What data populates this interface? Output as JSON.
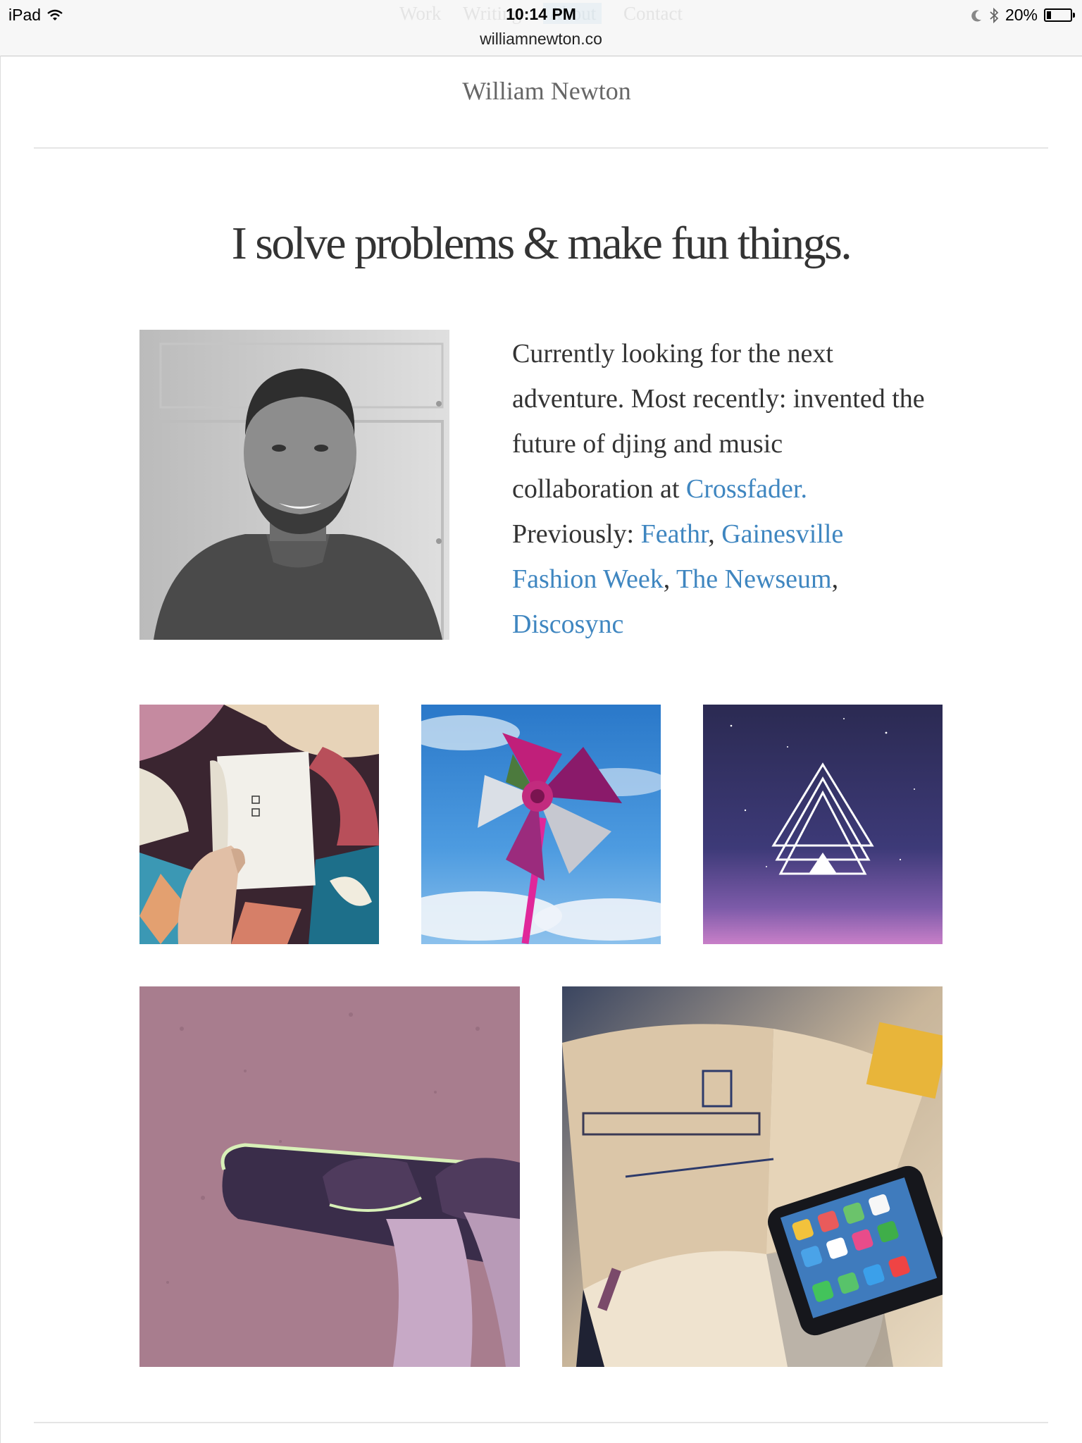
{
  "statusbar": {
    "device": "iPad",
    "time": "10:14 PM",
    "url": "williamnewton.co",
    "battery": "20%",
    "battery_level": 0.2,
    "icons": [
      "wifi-icon",
      "moon-icon",
      "bluetooth-icon",
      "battery-icon"
    ]
  },
  "ghost_nav": [
    "Work",
    "Writing",
    "About",
    "Contact"
  ],
  "site": {
    "title": "William Newton",
    "headline": "I solve problems & make fun things."
  },
  "intro": {
    "text_1": "Currently looking for the next adventure. Most recently: invented the future of djing and music collaboration at ",
    "link_crossfader": "Crossfader.",
    "text_2": " Previously: ",
    "link_feathr": "Feathr",
    "link_gfw": "Gainesville Fashion Week",
    "link_newseum": "The Newseum",
    "link_discosync": "Discosync",
    "sep": ", "
  },
  "colors": {
    "link": "#3f86c0",
    "text": "#333333",
    "title": "#666666",
    "rule": "#e5e5e5"
  }
}
